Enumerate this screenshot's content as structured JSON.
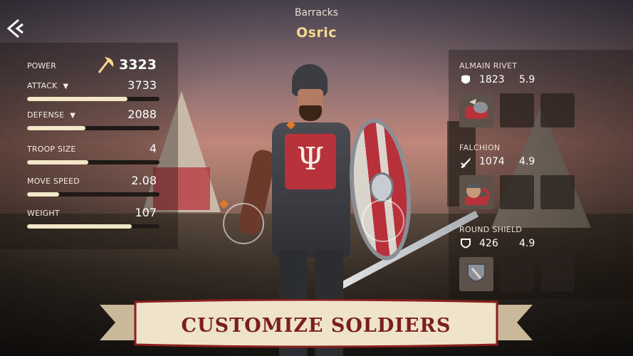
{
  "header": {
    "subtitle": "Barracks",
    "title": "Osric"
  },
  "stats": {
    "power": {
      "label": "POWER",
      "value": "3323"
    },
    "attack": {
      "label": "ATTACK",
      "value": "3733",
      "fill": 0.76
    },
    "defense": {
      "label": "DEFENSE",
      "value": "2088",
      "fill": 0.44
    },
    "troop_size": {
      "label": "TROOP SIZE",
      "value": "4",
      "fill": 0.46
    },
    "move_speed": {
      "label": "MOVE SPEED",
      "value": "2.08",
      "fill": 0.24
    },
    "weight": {
      "label": "WEIGHT",
      "value": "107",
      "fill": 0.79
    }
  },
  "equipment": [
    {
      "name": "ALMAIN RIVET",
      "value": "1823",
      "weight": "5.9",
      "icon": "armor-icon",
      "slot_icon": "helmet-icon"
    },
    {
      "name": "FALCHION",
      "value": "1074",
      "weight": "4.9",
      "icon": "sword-icon",
      "slot_icon": "soldier-head-icon"
    },
    {
      "name": "ROUND SHIELD",
      "value": "426",
      "weight": "4.9",
      "icon": "shield-icon",
      "slot_icon": "shield-icon"
    }
  ],
  "banner": {
    "text": "CUSTOMIZE SOLDIERS"
  },
  "colors": {
    "accent": "#f6d98c",
    "banner_text": "#7b1f1d",
    "bar_fill": "#f2e8c8",
    "tabard": "#b8323b"
  }
}
